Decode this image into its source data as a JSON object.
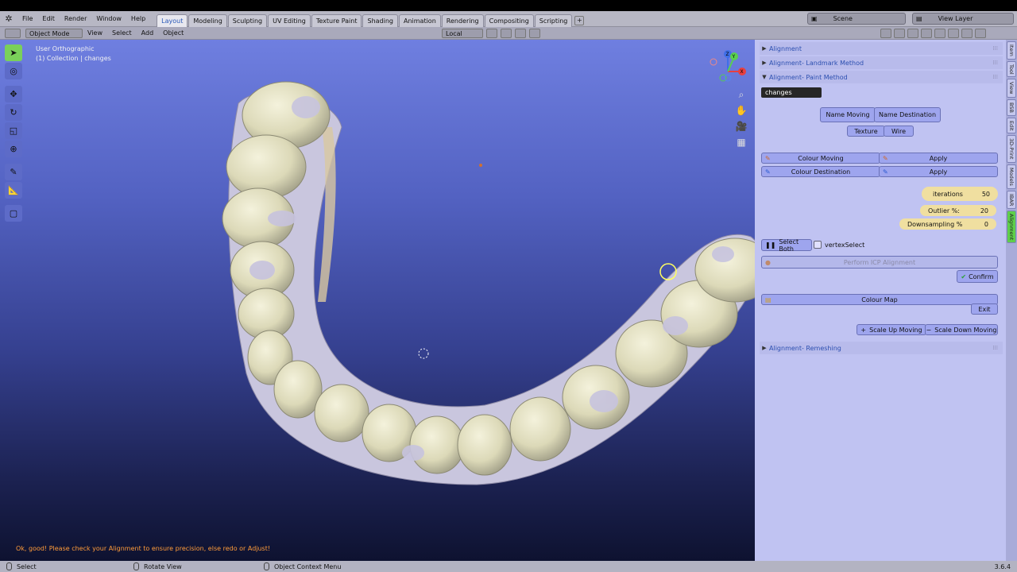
{
  "menubar": {
    "items": [
      "File",
      "Edit",
      "Render",
      "Window",
      "Help"
    ],
    "workspaces": [
      {
        "label": "Layout",
        "active": true
      },
      {
        "label": "Modeling"
      },
      {
        "label": "Sculpting"
      },
      {
        "label": "UV Editing"
      },
      {
        "label": "Texture Paint"
      },
      {
        "label": "Shading"
      },
      {
        "label": "Animation"
      },
      {
        "label": "Rendering"
      },
      {
        "label": "Compositing"
      },
      {
        "label": "Scripting"
      }
    ],
    "add_workspace": "+",
    "scene": "Scene",
    "view_layer": "View Layer"
  },
  "header": {
    "mode": "Object Mode",
    "menus": [
      "View",
      "Select",
      "Add",
      "Object"
    ],
    "transform_orientation": "Local"
  },
  "viewport": {
    "view_name": "User Orthographic",
    "collection": "(1) Collection | changes",
    "status_message": "Ok, good! Please check your Alignment to ensure precision, else redo or Adjust!",
    "gizmo": {
      "z": "Z",
      "y": "Y",
      "x": "X"
    }
  },
  "sidebar": {
    "panels": {
      "alignment": "Alignment",
      "landmark": "Alignment- Landmark Method",
      "paint": "Alignment- Paint Method",
      "remeshing": "Alignment- Remeshing"
    },
    "object_field": "changes",
    "name_moving": "Name Moving",
    "name_destination": "Name Destination",
    "texture": "Texture",
    "wire": "Wire",
    "colour_moving": "Colour Moving",
    "colour_destination": "Colour Destination",
    "apply": "Apply",
    "iterations_label": "iterations",
    "iterations_value": "50",
    "outlier_label": "Outlier %:",
    "outlier_value": "20",
    "downsampling_label": "Downsampling %",
    "downsampling_value": "0",
    "select_both": "Select Both",
    "vertex_select": "vertexSelect",
    "perform_icp": "Perform ICP Alignment",
    "confirm": "Confirm",
    "colour_map": "Colour Map",
    "exit": "Exit",
    "scale_up": "Scale Up  Moving",
    "scale_down": "Scale Down Moving",
    "tabs": [
      "Item",
      "Tool",
      "View",
      "BSB",
      "Edit",
      "3D-Print",
      "Models",
      "IBAR",
      "Alignment"
    ],
    "active_tab": "Alignment"
  },
  "statusbar": {
    "select": "Select",
    "rotate": "Rotate View",
    "context": "Object Context Menu",
    "version": "3.6.4"
  },
  "colors": {
    "accent_green": "#7ad05a",
    "panel_bg": "#c0c3f2",
    "message_orange": "#ff9c3a"
  }
}
